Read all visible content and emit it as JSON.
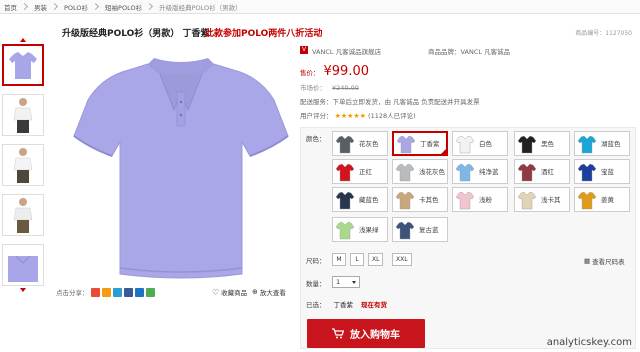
{
  "breadcrumb": [
    "首页",
    "男装",
    "POLO衫",
    "短袖POLO衫",
    "升级版经典POLO衫（男款）"
  ],
  "title": "升级版经典POLO衫（男款） 丁香紫",
  "promo": "此款参加POLO两件八折活动",
  "product_no": "商品编号：1127050",
  "store": {
    "icon": "V",
    "name": "VANCL 凡客诚品旗舰店",
    "brand": "商品品牌：VANCL 凡客诚品"
  },
  "price": {
    "label": "售价：",
    "value": "¥99.00"
  },
  "market_price": {
    "label": "市场价：",
    "value": "¥240.00"
  },
  "delivery": "配送服务：下单后立即发货，由 凡客诚品 负责配送并开具发票",
  "rating": {
    "label": "用户评分：",
    "stars": "★★★★★",
    "count": "(1128人已评论)"
  },
  "color_label": "颜色：",
  "colors": [
    {
      "name": "花灰色",
      "swatch": "#5a5f66"
    },
    {
      "name": "丁香紫",
      "swatch": "#a9a8e6",
      "selected": true
    },
    {
      "name": "白色",
      "swatch": "#f2f2f2"
    },
    {
      "name": "黑色",
      "swatch": "#222222"
    },
    {
      "name": "湖蓝色",
      "swatch": "#1aa6d7"
    },
    {
      "name": "正红",
      "swatch": "#d3141f"
    },
    {
      "name": "浅花灰色",
      "swatch": "#b8bcc0"
    },
    {
      "name": "纯净蓝",
      "swatch": "#7db6e8"
    },
    {
      "name": "酒红",
      "swatch": "#8f3a44"
    },
    {
      "name": "宝蓝",
      "swatch": "#1c3f9e"
    },
    {
      "name": "藏蓝色",
      "swatch": "#2a3550"
    },
    {
      "name": "卡其色",
      "swatch": "#c9a77c"
    },
    {
      "name": "浅粉",
      "swatch": "#f2c4cf"
    },
    {
      "name": "浅卡其",
      "swatch": "#e0d3b6"
    },
    {
      "name": "姜黄",
      "swatch": "#e09b18"
    },
    {
      "name": "浅果绿",
      "swatch": "#a9d98b"
    },
    {
      "name": "复古蓝",
      "swatch": "#3f5279"
    }
  ],
  "size_label": "尺码：",
  "sizes": [
    "M",
    "L",
    "XL",
    "XXL"
  ],
  "size_chart": "查看尺码表",
  "qty_label": "数量：",
  "qty_value": "1",
  "chosen": {
    "label": "已选：",
    "color": "丁香紫",
    "stock": "现在有货"
  },
  "cart_button": "放入购物车",
  "share": {
    "label": "点击分享："
  },
  "fav": "收藏商品",
  "zoom": "放大查看",
  "watermark": "analyticskey.com",
  "accent": "#c40000",
  "shirt_color": "#a8a6e8"
}
